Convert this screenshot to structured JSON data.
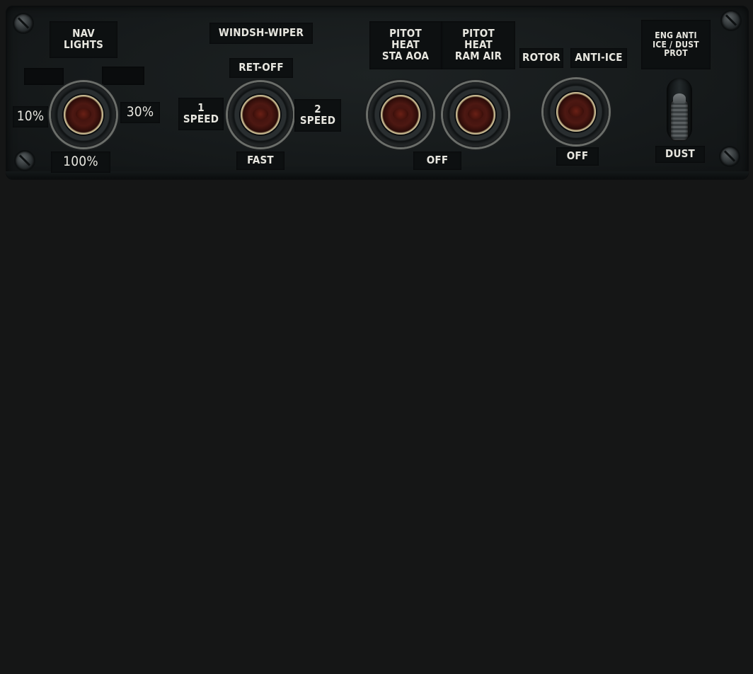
{
  "nav_lights": {
    "title_line1": "NAV",
    "title_line2": "LIGHTS",
    "pos_10": "10%",
    "pos_30": "30%",
    "pos_100": "100%"
  },
  "windshield_wiper": {
    "title": "WINDSH-WIPER",
    "ret_off": "RET-OFF",
    "speed1_num": "1",
    "speed1_word": "SPEED",
    "speed2_num": "2",
    "speed2_word": "SPEED",
    "fast": "FAST"
  },
  "pitot_heat": {
    "sta_aoa_line1": "PITOT",
    "sta_aoa_line2": "HEAT",
    "sta_aoa_line3": "STA AOA",
    "ram_air_line1": "PITOT",
    "ram_air_line2": "HEAT",
    "ram_air_line3": "RAM AIR",
    "off": "OFF"
  },
  "rotor_anti_ice": {
    "rotor": "ROTOR",
    "anti_ice": "ANTI-ICE",
    "off": "OFF"
  },
  "eng_anti_ice": {
    "line1": "ENG ANTI",
    "line2": "ICE / DUST",
    "line3": "PROT",
    "dust": "DUST"
  }
}
